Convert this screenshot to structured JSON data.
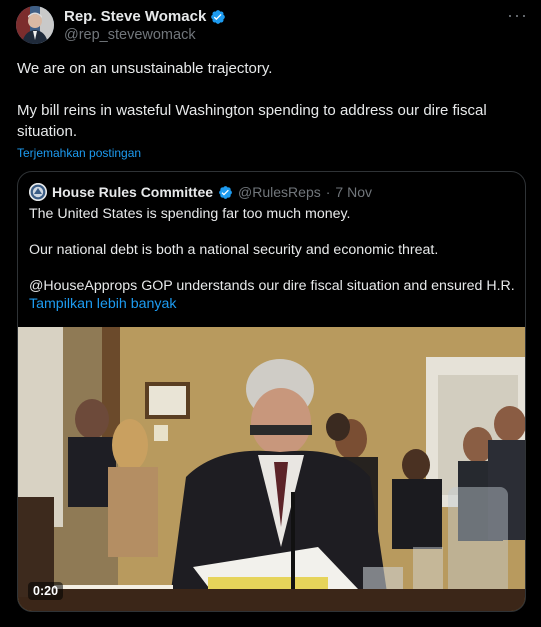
{
  "author": {
    "display_name": "Rep. Steve Womack",
    "handle": "@rep_stevewomack",
    "avatar_icon": "profile-photo",
    "verified_icon": "verified-badge-icon"
  },
  "tweet": {
    "paragraphs": [
      "We are on an unsustainable trajectory.",
      "My bill reins in wasteful Washington spending to address our dire fiscal situation."
    ],
    "translate_label": "Terjemahkan postingan",
    "more_icon": "more-options-icon"
  },
  "quote": {
    "display_name": "House Rules Committee",
    "handle": "@RulesReps",
    "separator": "·",
    "date": "7 Nov",
    "paragraphs": [
      "The United States is spending far too much money.",
      "Our national debt is both a national security and economic threat.",
      "@HouseApprops GOP understands our dire fiscal situation and ensured H.R. ..."
    ],
    "show_more_label": "Tampilkan lebih banyak"
  },
  "video": {
    "timestamp": "0:20"
  },
  "colors": {
    "background": "#000000",
    "text": "#e7e9ea",
    "muted": "#71767b",
    "link": "#1d9bf0",
    "border": "#2f3336"
  }
}
